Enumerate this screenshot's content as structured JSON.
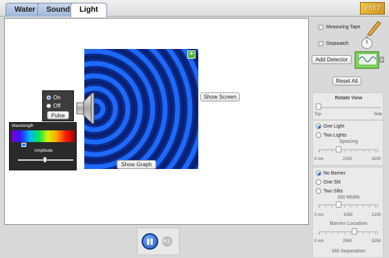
{
  "tabs": [
    {
      "label": "Water",
      "active": false
    },
    {
      "label": "Sound",
      "active": false
    },
    {
      "label": "Light",
      "active": true
    }
  ],
  "logo": {
    "text": "PhET"
  },
  "play_area": {
    "show_screen_label": "Show Screen",
    "show_graph_label": "Show Graph",
    "light_source": {
      "mode_options": [
        "On",
        "Off"
      ],
      "selected_mode": "On",
      "pulse_label": "Pulse"
    },
    "wavelength_panel": {
      "title": "Wavelength",
      "amplitude_label": "Amplitude"
    }
  },
  "clock": {
    "pause_icon": "pause-icon",
    "step_icon": "step-forward-icon"
  },
  "side": {
    "measuring_tape_label": "Measuring Tape",
    "stopwatch_label": "Stopwatch",
    "add_detector_label": "Add Detector",
    "reset_all_label": "Reset All",
    "rotate_view": {
      "title": "Rotate View",
      "left_label": "Top",
      "right_label": "Side",
      "value": 0
    },
    "lights": {
      "options": [
        "One Light",
        "Two Lights"
      ],
      "selected": "One Light",
      "spacing_title": "Spacing",
      "spacing_ticks": [
        "0 nm",
        "2100",
        "4200"
      ]
    },
    "barrier": {
      "options": [
        "No Barrier",
        "One Slit",
        "Two Slits"
      ],
      "selected": "No Barrier",
      "slit_width_title": "Slit Width",
      "slit_width_ticks": [
        "0 nm",
        "1050",
        "2100"
      ],
      "barrier_location_title": "Barrier Location",
      "barrier_location_ticks": [
        "0 nm",
        "2590",
        "5250"
      ],
      "slit_separation_title": "Slit Separation"
    }
  },
  "colors": {
    "wave_dark": "#0a2a8c",
    "wave_light": "#1f6dff",
    "accent_blue": "#2f6fd8"
  }
}
